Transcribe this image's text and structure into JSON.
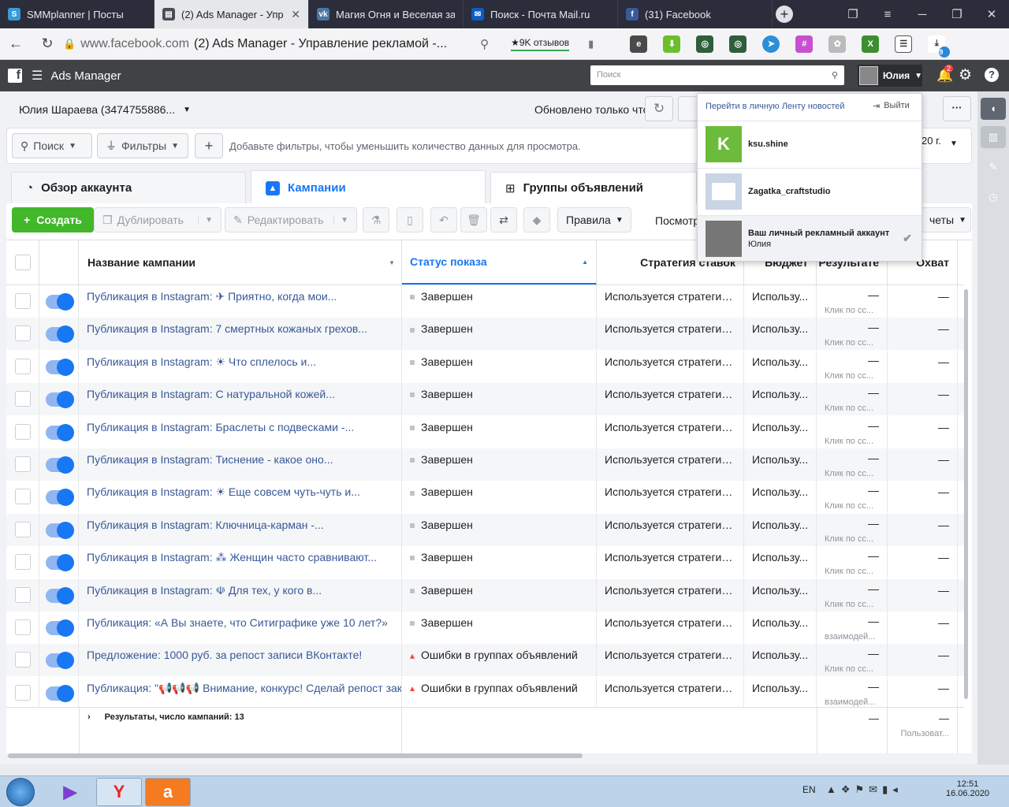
{
  "browser": {
    "tabs": [
      {
        "title": "SMMplanner | Посты",
        "active": false,
        "icon": "smmplanner-icon"
      },
      {
        "title": "(2) Ads Manager - Упр",
        "active": true,
        "icon": "ads-manager-icon"
      },
      {
        "title": "Магия Огня и Веселая за",
        "active": false,
        "icon": "vk-icon"
      },
      {
        "title": "Поиск - Почта Mail.ru",
        "active": false,
        "icon": "mail-icon"
      },
      {
        "title": "(31) Facebook",
        "active": false,
        "icon": "facebook-icon"
      }
    ],
    "url_domain": "www.facebook.com",
    "url_title": "(2) Ads Manager - Управление рекламой -...",
    "reviews_label": "★9K отзывов",
    "ext_badge": "9"
  },
  "fb_header": {
    "app_name": "Ads Manager",
    "search_placeholder": "Поиск",
    "user_name": "Юлия",
    "notif_count": "2"
  },
  "toolbar": {
    "account_name": "Юлия Шараева (3474755886...",
    "updated_text": "Обновлено только что",
    "search_label": "Поиск",
    "filters_label": "Фильтры",
    "filter_hint": "Добавьте фильтры, чтобы уменьшить количество данных для просмотра.",
    "date_partial": "20 г."
  },
  "tabs": [
    {
      "label": "Обзор аккаунта"
    },
    {
      "label": "Кампании"
    },
    {
      "label": "Группы объявлений"
    }
  ],
  "actions": {
    "create": "Создать",
    "duplicate": "Дублировать",
    "edit": "Редактировать",
    "rules": "Правила",
    "view_partial": "Посмотр",
    "reports_partial": "четы"
  },
  "columns": {
    "name": "Название кампании",
    "status": "Статус показа",
    "strategy": "Стратегия ставок",
    "budget": "Бюджет",
    "results": "Результате",
    "reach": "Охват"
  },
  "rows": [
    {
      "name": "Публикация в Instagram: ✈ Приятно, когда мои...",
      "status": "Завершен",
      "error": false,
      "strategy": "Используется стратегия с...",
      "budget": "Использу...",
      "result": "—",
      "result_sub": "Клик по сс...",
      "reach": "—"
    },
    {
      "name": "Публикация в Instagram: 7 смертных кожаных грехов...",
      "status": "Завершен",
      "error": false,
      "strategy": "Используется стратегия с...",
      "budget": "Использу...",
      "result": "—",
      "result_sub": "Клик по сс...",
      "reach": "—"
    },
    {
      "name": "Публикация в Instagram: ☀ Что сплелось и...",
      "status": "Завершен",
      "error": false,
      "strategy": "Используется стратегия с...",
      "budget": "Использу...",
      "result": "—",
      "result_sub": "Клик по сс...",
      "reach": "—"
    },
    {
      "name": "Публикация в Instagram: С натуральной кожей...",
      "status": "Завершен",
      "error": false,
      "strategy": "Используется стратегия с...",
      "budget": "Использу...",
      "result": "—",
      "result_sub": "Клик по сс...",
      "reach": "—"
    },
    {
      "name": "Публикация в Instagram: Браслеты с подвесками -...",
      "status": "Завершен",
      "error": false,
      "strategy": "Используется стратегия с...",
      "budget": "Использу...",
      "result": "—",
      "result_sub": "Клик по сс...",
      "reach": "—"
    },
    {
      "name": "Публикация в Instagram: Тиснение - какое оно...",
      "status": "Завершен",
      "error": false,
      "strategy": "Используется стратегия с...",
      "budget": "Использу...",
      "result": "—",
      "result_sub": "Клик по сс...",
      "reach": "—"
    },
    {
      "name": "Публикация в Instagram: ☀ Еще совсем чуть-чуть и...",
      "status": "Завершен",
      "error": false,
      "strategy": "Используется стратегия с...",
      "budget": "Использу...",
      "result": "—",
      "result_sub": "Клик по сс...",
      "reach": "—"
    },
    {
      "name": "Публикация в Instagram: Ключница-карман -...",
      "status": "Завершен",
      "error": false,
      "strategy": "Используется стратегия с...",
      "budget": "Использу...",
      "result": "—",
      "result_sub": "Клик по сс...",
      "reach": "—"
    },
    {
      "name": "Публикация в Instagram: ⁂ Женщин часто сравнивают...",
      "status": "Завершен",
      "error": false,
      "strategy": "Используется стратегия с...",
      "budget": "Использу...",
      "result": "—",
      "result_sub": "Клик по сс...",
      "reach": "—"
    },
    {
      "name": "Публикация в Instagram: ☫ Для тех, у кого в...",
      "status": "Завершен",
      "error": false,
      "strategy": "Используется стратегия с...",
      "budget": "Использу...",
      "result": "—",
      "result_sub": "Клик по сс...",
      "reach": "—"
    },
    {
      "name": "Публикация: «А Вы знаете, что Ситиграфике уже 10 лет?»",
      "status": "Завершен",
      "error": false,
      "strategy": "Используется стратегия с...",
      "budget": "Использу...",
      "result": "—",
      "result_sub": "взаимодей...",
      "reach": "—"
    },
    {
      "name": "Предложение: 1000 руб. за репост записи ВКонтакте!",
      "status": "Ошибки в группах объявлений",
      "error": true,
      "strategy": "Используется стратегия с...",
      "budget": "Использу...",
      "result": "—",
      "result_sub": "Клик по сс...",
      "reach": "—"
    },
    {
      "name": "Публикация: \"📢📢📢 Внимание, конкурс! Сделай репост закреп...",
      "status": "Ошибки в группах объявлений",
      "error": true,
      "strategy": "Используется стратегия с...",
      "budget": "Использу...",
      "result": "—",
      "result_sub": "взаимодей...",
      "reach": "—"
    }
  ],
  "footer": {
    "summary": "Результаты, число кампаний: 13",
    "result": "—",
    "reach": "—",
    "reach_sub": "Пользоват..."
  },
  "dropdown": {
    "feed_link": "Перейти в личную Ленту новостей",
    "logout": "Выйти",
    "accounts": [
      {
        "name": "ksu.shine",
        "sub": "",
        "avatar_letter": "K",
        "avatar_color": "#6dbb3b",
        "checked": false
      },
      {
        "name": "Zagatka_craftstudio",
        "sub": "",
        "avatar_letter": "",
        "avatar_color": "#c9d4e4",
        "checked": false
      },
      {
        "name": "Ваш личный рекламный аккаунт",
        "sub": "Юлия",
        "avatar_letter": "",
        "avatar_color": "#777",
        "checked": true
      }
    ]
  },
  "taskbar": {
    "lang": "EN",
    "time": "12:51",
    "date": "16.06.2020"
  }
}
